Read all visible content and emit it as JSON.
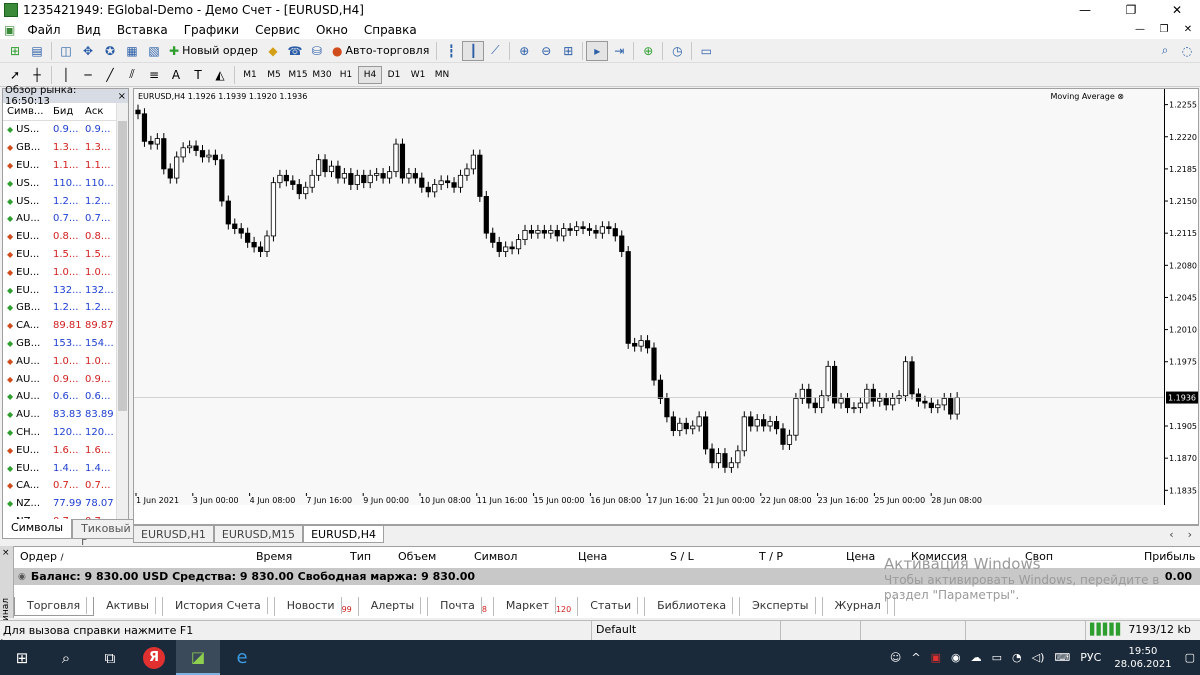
{
  "window": {
    "title": "1235421949: EGlobal-Demo - Демо Счет - [EURUSD,H4]",
    "minimize": "—",
    "maximize": "❐",
    "close": "✕"
  },
  "menu": {
    "items": [
      "Файл",
      "Вид",
      "Вставка",
      "Графики",
      "Сервис",
      "Окно",
      "Справка"
    ]
  },
  "toolbar": {
    "new_order": "Новый ордер",
    "autotrade": "Авто-торговля",
    "timeframes": [
      "M1",
      "M5",
      "M15",
      "M30",
      "H1",
      "H4",
      "D1",
      "W1",
      "MN"
    ],
    "active_timeframe": "H4"
  },
  "market_watch": {
    "title": "Обзор рынка: 16:50:13",
    "col_symbol": "Симв...",
    "col_bid": "Бид",
    "col_ask": "Аск",
    "rows": [
      {
        "sym": "US...",
        "bid": "0.9...",
        "ask": "0.9...",
        "dir": "up",
        "color": "blue"
      },
      {
        "sym": "GB...",
        "bid": "1.3...",
        "ask": "1.3...",
        "dir": "dn",
        "color": "red"
      },
      {
        "sym": "EU...",
        "bid": "1.1...",
        "ask": "1.1...",
        "dir": "dn",
        "color": "red"
      },
      {
        "sym": "US...",
        "bid": "110...",
        "ask": "110...",
        "dir": "up",
        "color": "blue"
      },
      {
        "sym": "US...",
        "bid": "1.2...",
        "ask": "1.2...",
        "dir": "up",
        "color": "blue"
      },
      {
        "sym": "AU...",
        "bid": "0.7...",
        "ask": "0.7...",
        "dir": "up",
        "color": "blue"
      },
      {
        "sym": "EU...",
        "bid": "0.8...",
        "ask": "0.8...",
        "dir": "dn",
        "color": "red"
      },
      {
        "sym": "EU...",
        "bid": "1.5...",
        "ask": "1.5...",
        "dir": "dn",
        "color": "red"
      },
      {
        "sym": "EU...",
        "bid": "1.0...",
        "ask": "1.0...",
        "dir": "dn",
        "color": "red"
      },
      {
        "sym": "EU...",
        "bid": "132...",
        "ask": "132...",
        "dir": "up",
        "color": "blue"
      },
      {
        "sym": "GB...",
        "bid": "1.2...",
        "ask": "1.2...",
        "dir": "up",
        "color": "blue"
      },
      {
        "sym": "CA...",
        "bid": "89.81",
        "ask": "89.87",
        "dir": "dn",
        "color": "red"
      },
      {
        "sym": "GB...",
        "bid": "153...",
        "ask": "154...",
        "dir": "up",
        "color": "blue"
      },
      {
        "sym": "AU...",
        "bid": "1.0...",
        "ask": "1.0...",
        "dir": "dn",
        "color": "red"
      },
      {
        "sym": "AU...",
        "bid": "0.9...",
        "ask": "0.9...",
        "dir": "dn",
        "color": "red"
      },
      {
        "sym": "AU...",
        "bid": "0.6...",
        "ask": "0.6...",
        "dir": "up",
        "color": "blue"
      },
      {
        "sym": "AU...",
        "bid": "83.83",
        "ask": "83.89",
        "dir": "up",
        "color": "blue"
      },
      {
        "sym": "CH...",
        "bid": "120...",
        "ask": "120...",
        "dir": "up",
        "color": "blue"
      },
      {
        "sym": "EU...",
        "bid": "1.6...",
        "ask": "1.6...",
        "dir": "dn",
        "color": "red"
      },
      {
        "sym": "EU...",
        "bid": "1.4...",
        "ask": "1.4...",
        "dir": "up",
        "color": "blue"
      },
      {
        "sym": "CA...",
        "bid": "0.7...",
        "ask": "0.7...",
        "dir": "dn",
        "color": "red"
      },
      {
        "sym": "NZ...",
        "bid": "77.99",
        "ask": "78.07",
        "dir": "up",
        "color": "blue"
      },
      {
        "sym": "NZ...",
        "bid": "0.7...",
        "ask": "0.7...",
        "dir": "dn",
        "color": "red"
      }
    ],
    "tabs": [
      "Символы",
      "Тиковый г"
    ]
  },
  "chart_header": {
    "info": "EURUSD,H4  1.1926 1.1939 1.1920 1.1936",
    "indicator": "Moving Average"
  },
  "chart_data": {
    "type": "candlestick",
    "symbol": "EURUSD",
    "timeframe": "H4",
    "ohlc_last": {
      "open": 1.1926,
      "high": 1.1939,
      "low": 1.192,
      "close": 1.1936
    },
    "ylim": [
      1.1819,
      1.2272
    ],
    "y_ticks": [
      1.2255,
      1.222,
      1.2185,
      1.215,
      1.2115,
      1.208,
      1.2045,
      1.201,
      1.1975,
      1.1905,
      1.187,
      1.1835
    ],
    "current_price_label": "1.1936",
    "x_ticks": [
      "1 Jun 2021",
      "3 Jun 00:00",
      "4 Jun 08:00",
      "7 Jun 16:00",
      "9 Jun 00:00",
      "10 Jun 08:00",
      "11 Jun 16:00",
      "15 Jun 00:00",
      "16 Jun 08:00",
      "17 Jun 16:00",
      "21 Jun 00:00",
      "22 Jun 08:00",
      "23 Jun 16:00",
      "25 Jun 00:00",
      "28 Jun 08:00"
    ],
    "close": [
      1.2245,
      1.2215,
      1.2212,
      1.2218,
      1.2185,
      1.2175,
      1.2198,
      1.2208,
      1.221,
      1.2205,
      1.2198,
      1.22,
      1.2195,
      1.215,
      1.2125,
      1.212,
      1.2115,
      1.2105,
      1.21,
      1.2095,
      1.2112,
      1.217,
      1.2178,
      1.2172,
      1.2168,
      1.2158,
      1.2165,
      1.2178,
      1.2195,
      1.2182,
      1.2188,
      1.2175,
      1.218,
      1.2168,
      1.2178,
      1.217,
      1.2178,
      1.218,
      1.2175,
      1.2182,
      1.2212,
      1.2175,
      1.218,
      1.2175,
      1.2165,
      1.216,
      1.2168,
      1.2172,
      1.217,
      1.2165,
      1.2178,
      1.2185,
      1.22,
      1.2155,
      1.2115,
      1.2105,
      1.2095,
      1.21,
      1.2098,
      1.2108,
      1.2118,
      1.2115,
      1.2118,
      1.2115,
      1.2118,
      1.2112,
      1.212,
      1.2118,
      1.2122,
      1.212,
      1.2118,
      1.2115,
      1.2122,
      1.212,
      1.2112,
      1.2095,
      1.1995,
      1.1992,
      1.1998,
      1.199,
      1.1955,
      1.1935,
      1.1915,
      1.19,
      1.1908,
      1.1902,
      1.1905,
      1.1915,
      1.188,
      1.1865,
      1.1875,
      1.186,
      1.1865,
      1.1878,
      1.1915,
      1.1905,
      1.1912,
      1.1905,
      1.191,
      1.1902,
      1.1885,
      1.1895,
      1.1935,
      1.1945,
      1.193,
      1.1925,
      1.1938,
      1.197,
      1.193,
      1.1935,
      1.1925,
      1.1925,
      1.193,
      1.1945,
      1.1932,
      1.1935,
      1.1928,
      1.1935,
      1.1938,
      1.1975,
      1.194,
      1.1932,
      1.193,
      1.1925,
      1.1928,
      1.1935,
      1.1918,
      1.1936
    ],
    "trend_points": [
      1.225,
      1.2215,
      1.221,
      1.2185,
      1.213,
      1.21,
      1.217,
      1.218,
      1.2165,
      1.218,
      1.2175,
      1.2165,
      1.219,
      1.211,
      1.21,
      1.212,
      1.2115,
      1.209,
      1.1985,
      1.194,
      1.1905,
      1.186,
      1.1905,
      1.1885,
      1.194,
      1.193,
      1.1935,
      1.1945,
      1.193,
      1.1936
    ],
    "xlabel": "",
    "ylabel": "",
    "grid": false
  },
  "chart_tabs": [
    "EURUSD,H1",
    "EURUSD,M15",
    "EURUSD,H4"
  ],
  "terminal": {
    "side_label": "Терминал",
    "columns": {
      "order": "Ордер",
      "time": "Время",
      "type": "Тип",
      "volume": "Объем",
      "symbol": "Символ",
      "price": "Цена",
      "sl": "S / L",
      "tp": "T / P",
      "price2": "Цена",
      "commission": "Комиссия",
      "swap": "Своп",
      "profit": "Прибыль"
    },
    "balance_text": "Баланс: 9 830.00 USD  Средства: 9 830.00  Свободная маржа: 9 830.00",
    "balance_profit": "0.00",
    "tabs": [
      {
        "label": "Торговля",
        "badge": ""
      },
      {
        "label": "Активы",
        "badge": ""
      },
      {
        "label": "История Счета",
        "badge": ""
      },
      {
        "label": "Новости",
        "badge": "99"
      },
      {
        "label": "Алерты",
        "badge": ""
      },
      {
        "label": "Почта",
        "badge": "8"
      },
      {
        "label": "Маркет",
        "badge": "120"
      },
      {
        "label": "Статьи",
        "badge": ""
      },
      {
        "label": "Библиотека",
        "badge": ""
      },
      {
        "label": "Эксперты",
        "badge": ""
      },
      {
        "label": "Журнал",
        "badge": ""
      }
    ]
  },
  "watermark": {
    "line1": "Активация Windows",
    "line2": "Чтобы активировать Windows, перейдите в",
    "line3": "раздел \"Параметры\"."
  },
  "status": {
    "help": "Для вызова справки нажмите F1",
    "profile": "Default",
    "traffic": "7193/12 kb"
  },
  "taskbar": {
    "lang": "РУС",
    "time": "19:50",
    "date": "28.06.2021"
  },
  "colors": {
    "chart_bg": "#f8f8f8",
    "candle": "#000000",
    "up_arrow": "#2e9e2e",
    "down_arrow": "#d04c1c"
  }
}
